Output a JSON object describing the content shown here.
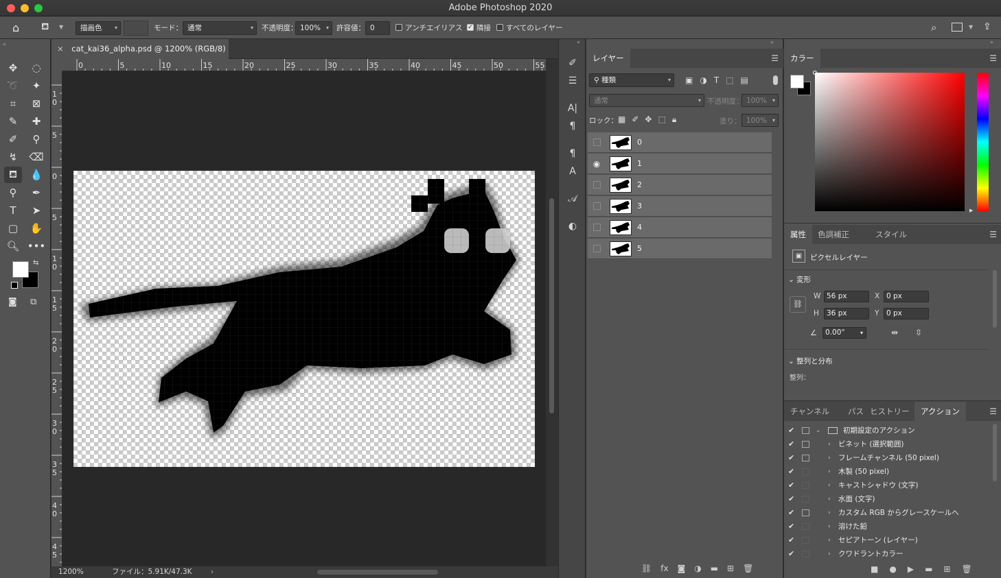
{
  "window": {
    "title": "Adobe Photoshop 2020"
  },
  "options_bar": {
    "fill_source": "描画色",
    "mode_label": "モード：",
    "mode_value": "通常",
    "opacity_label": "不透明度：",
    "opacity_value": "100%",
    "tolerance_label": "許容値：",
    "tolerance_value": "0",
    "antialias_label": "アンチエイリアス",
    "antialias_checked": false,
    "contiguous_label": "隣接",
    "contiguous_checked": true,
    "all_layers_label": "すべてのレイヤー",
    "all_layers_checked": false
  },
  "document": {
    "tab_title": "cat_kai36_alpha.psd @ 1200% (RGB/8)",
    "ruler_top": [
      "0",
      "5",
      "10",
      "15",
      "20",
      "25",
      "30",
      "35",
      "40",
      "45",
      "50",
      "55"
    ],
    "ruler_left": [
      "1\n0",
      "5",
      "0",
      "5",
      "1\n0",
      "1\n5",
      "2\n0",
      "2\n5",
      "3\n0",
      "3\n5",
      "4\n0",
      "4\n5"
    ],
    "zoom": "1200%",
    "file_info": "ファイル：5.91K/47.3K"
  },
  "layers_panel": {
    "tab": "レイヤー",
    "filter_kind": "種類",
    "blend_mode": "通常",
    "opacity_label": "不透明度：",
    "opacity_value": "100%",
    "lock_label": "ロック：",
    "fill_label": "塗り：",
    "fill_value": "100%",
    "layers": [
      {
        "name": "0",
        "visible": false
      },
      {
        "name": "1",
        "visible": true
      },
      {
        "name": "2",
        "visible": false
      },
      {
        "name": "3",
        "visible": false
      },
      {
        "name": "4",
        "visible": false
      },
      {
        "name": "5",
        "visible": false
      }
    ]
  },
  "color_panel": {
    "tab": "カラー",
    "foreground": "#ffffff",
    "background": "#000000"
  },
  "properties_panel": {
    "tabs": [
      "属性",
      "色調補正",
      "スタイル"
    ],
    "layer_type": "ピクセルレイヤー",
    "transform_header": "変形",
    "w_label": "W",
    "w_value": "56 px",
    "h_label": "H",
    "h_value": "36 px",
    "x_label": "X",
    "x_value": "0 px",
    "y_label": "Y",
    "y_value": "0 px",
    "angle_value": "0.00°",
    "align_header": "整列と分布",
    "align_label": "整列："
  },
  "actions_panel": {
    "tabs": [
      "チャンネル",
      "パス",
      "ヒストリー",
      "アクション"
    ],
    "set_name": "初期設定のアクション",
    "actions": [
      {
        "name": "ビネット (選択範囲)",
        "dialog": true
      },
      {
        "name": "フレームチャンネル (50 pixel)",
        "dialog": true
      },
      {
        "name": "木製 (50 pixel)",
        "dialog": false
      },
      {
        "name": "キャストシャドウ (文字)",
        "dialog": false
      },
      {
        "name": "水面 (文字)",
        "dialog": false
      },
      {
        "name": "カスタム RGB からグレースケールへ",
        "dialog": true
      },
      {
        "name": "溶けた鉛",
        "dialog": false
      },
      {
        "name": "セピアトーン (レイヤー)",
        "dialog": false
      },
      {
        "name": "クワドラントカラー",
        "dialog": false
      }
    ]
  }
}
